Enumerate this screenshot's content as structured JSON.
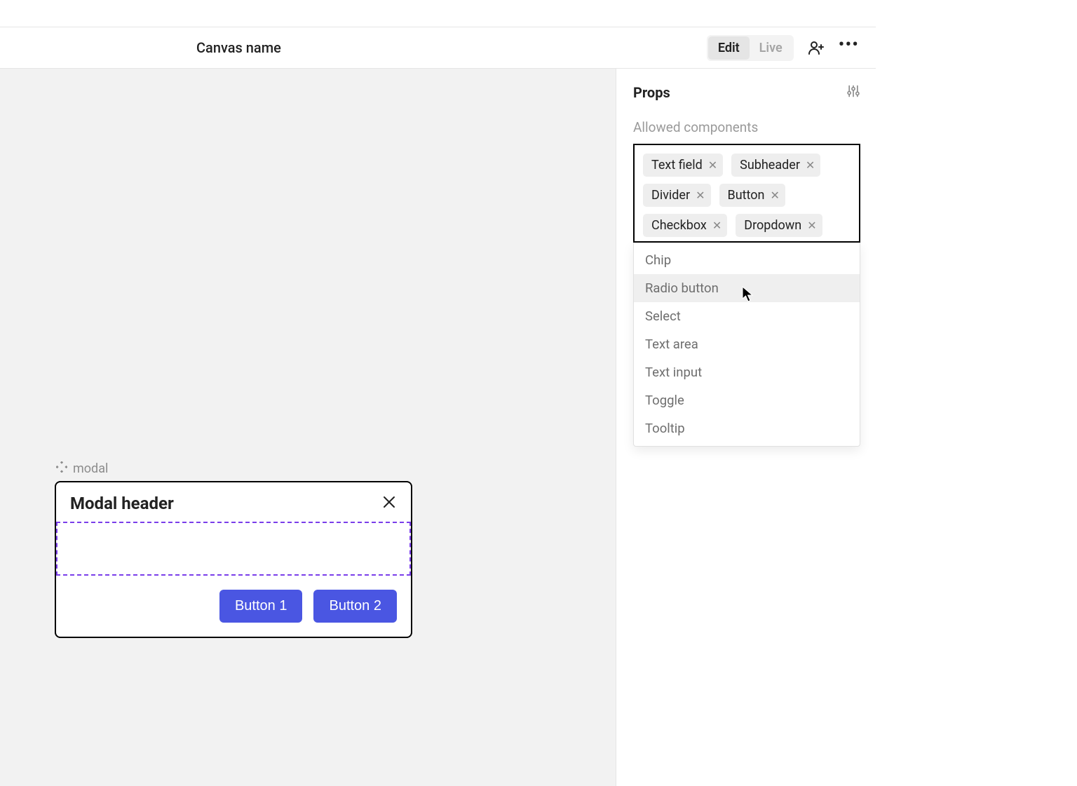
{
  "toolbar": {
    "canvas_title": "Canvas name",
    "mode_edit": "Edit",
    "mode_live": "Live"
  },
  "modal": {
    "label": "modal",
    "header": "Modal header",
    "button1": "Button 1",
    "button2": "Button 2"
  },
  "props": {
    "title": "Props",
    "allowed_label": "Allowed components",
    "chips": [
      {
        "label": "Text field"
      },
      {
        "label": "Subheader"
      },
      {
        "label": "Divider"
      },
      {
        "label": "Button"
      },
      {
        "label": "Checkbox"
      },
      {
        "label": "Dropdown"
      }
    ],
    "dropdown_options": [
      {
        "label": "Chip",
        "highlighted": false
      },
      {
        "label": "Radio button",
        "highlighted": true
      },
      {
        "label": "Select",
        "highlighted": false
      },
      {
        "label": "Text area",
        "highlighted": false
      },
      {
        "label": "Text input",
        "highlighted": false
      },
      {
        "label": "Toggle",
        "highlighted": false
      },
      {
        "label": "Tooltip",
        "highlighted": false
      }
    ]
  }
}
